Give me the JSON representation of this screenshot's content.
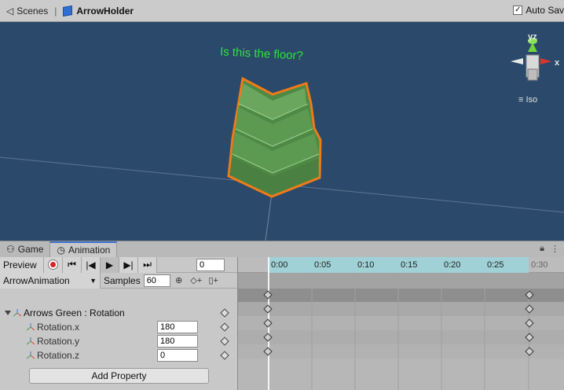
{
  "scene_header": {
    "tab_label": "Scenes",
    "object_name": "ArrowHolder",
    "autosave_label": "Auto Sav",
    "autosave_checked": "✓"
  },
  "scene": {
    "floor_label": "Is this the floor?",
    "gizmo": {
      "y_label": "yz",
      "x_label": "x",
      "projection_label": "Iso"
    }
  },
  "panel_tabs": [
    {
      "label": "Game"
    },
    {
      "label": "Animation"
    }
  ],
  "animation": {
    "preview_label": "Preview",
    "current_frame": "0",
    "clip_name": "ArrowAnimation",
    "samples_label": "Samples",
    "samples_value": "60",
    "group_label": "Arrows Green : Rotation",
    "properties": [
      {
        "label": "Rotation.x",
        "value": "180"
      },
      {
        "label": "Rotation.y",
        "value": "180"
      },
      {
        "label": "Rotation.z",
        "value": "0"
      }
    ],
    "add_property_label": "Add Property",
    "ruler_ticks": [
      "0:00",
      "0:05",
      "0:10",
      "0:15",
      "0:20",
      "0:25",
      "0:30"
    ]
  },
  "colors": {
    "scene_bg": "#2b4a6b",
    "floor_label": "#2ee03a",
    "selection_outline": "#f07a18",
    "timeline_range": "#9fd1d6"
  }
}
